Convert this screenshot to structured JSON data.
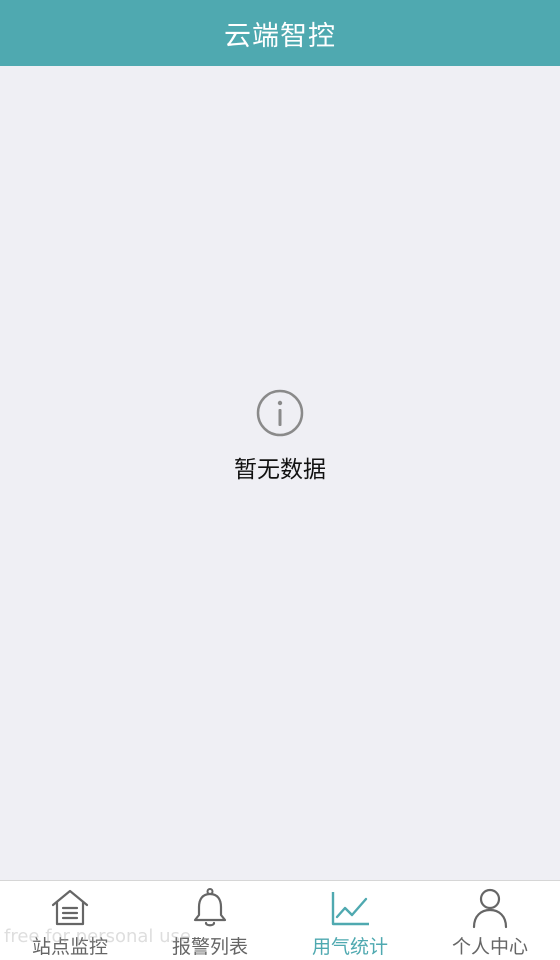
{
  "header": {
    "title": "云端智控"
  },
  "empty_state": {
    "icon": "info-icon",
    "text": "暂无数据"
  },
  "tabbar": {
    "items": [
      {
        "label": "站点监控",
        "icon": "home-list-icon",
        "active": false
      },
      {
        "label": "报警列表",
        "icon": "bell-icon",
        "active": false
      },
      {
        "label": "用气统计",
        "icon": "line-chart-icon",
        "active": true
      },
      {
        "label": "个人中心",
        "icon": "person-icon",
        "active": false
      }
    ]
  },
  "colors": {
    "accent": "#4fa9b0",
    "background": "#efeff4",
    "tab_inactive": "#666666"
  },
  "watermark": "free for personal use"
}
